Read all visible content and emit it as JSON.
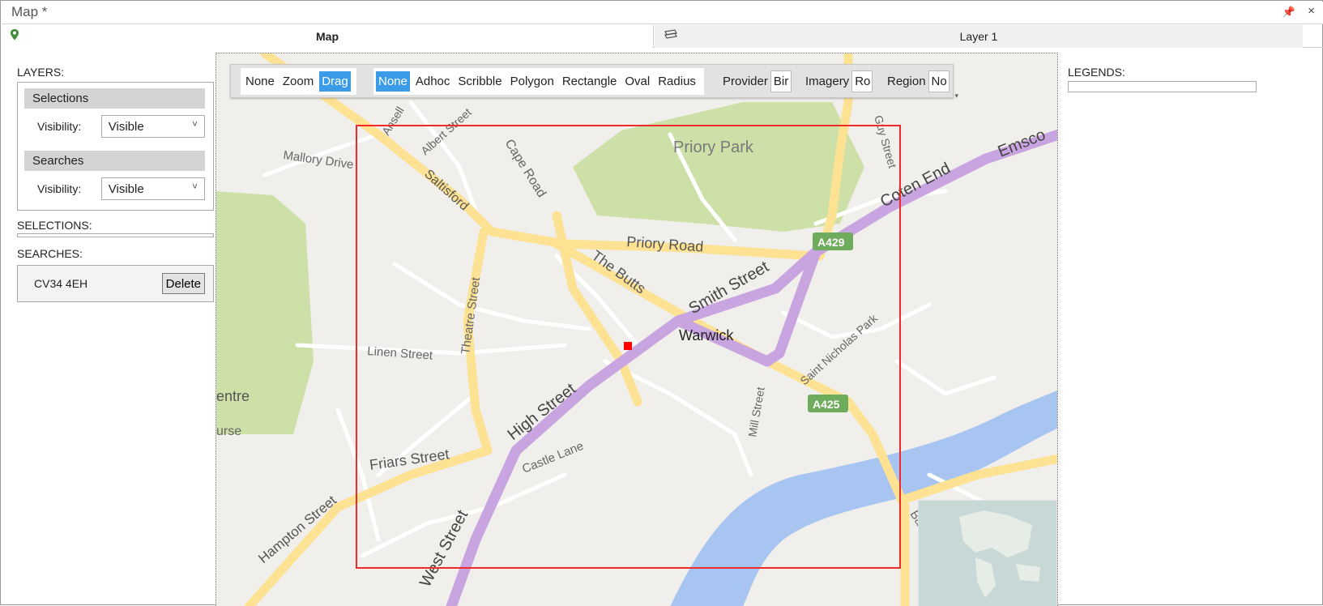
{
  "window": {
    "title": "Map *",
    "pin_icon": "pin-icon",
    "close_icon": "close-icon",
    "pin_glyph": "📌",
    "close_glyph": "×"
  },
  "tabs": [
    {
      "label": "Map",
      "icon": "map-pin-icon",
      "active": true
    },
    {
      "label": "Layer 1",
      "icon": "layers-icon",
      "active": false
    }
  ],
  "layers": {
    "heading": "LAYERS:",
    "groups": [
      {
        "name": "Selections",
        "visibility_label": "Visibility:",
        "visibility_value": "Visible"
      },
      {
        "name": "Searches",
        "visibility_label": "Visibility:",
        "visibility_value": "Visible"
      }
    ]
  },
  "selections": {
    "heading": "SELECTIONS:"
  },
  "searches": {
    "heading": "SEARCHES:",
    "items": [
      {
        "query": "CV34 4EH",
        "delete_label": "Delete"
      }
    ]
  },
  "legends": {
    "heading": "LEGENDS:"
  },
  "toolbar": {
    "mode_buttons": [
      "None",
      "Zoom",
      "Drag"
    ],
    "mode_active": "Drag",
    "shape_buttons": [
      "None",
      "Adhoc",
      "Scribble",
      "Polygon",
      "Rectangle",
      "Oval",
      "Radius"
    ],
    "shape_active": "None",
    "provider_label": "Provider",
    "provider_value": "Bir",
    "imagery_label": "Imagery",
    "imagery_value": "Ro",
    "region_label": "Region",
    "region_value": "No"
  },
  "map": {
    "labels": {
      "priory_park": "Priory Park",
      "warwick": "Warwick",
      "coten_end": "Coten End",
      "emsco": "Emsco",
      "priory_road": "Priory Road",
      "the_butts": "The Butts",
      "smith_street": "Smith Street",
      "high_street": "High Street",
      "west_street": "West Street",
      "friars_street": "Friars Street",
      "hampton_street": "Hampton Street",
      "castle_lane": "Castle Lane",
      "mill_street": "Mill Street",
      "saint_nicholas_park": "Saint Nicholas Park",
      "linen_street": "Linen Street",
      "theatre_street": "Theatre Street",
      "cape_road": "Cape Road",
      "saltisford": "Saltisford",
      "albert_street": "Albert Street",
      "ansell": "Ansell",
      "mallory_drive": "Mallory Drive",
      "guy_street": "Guy Street",
      "banbury": "Banbury R",
      "a429": "A429",
      "a425": "A425",
      "centre": "entre",
      "course": "urse"
    },
    "colors": {
      "background": "#f0efeb",
      "park": "#cde0a8",
      "major_road": "#fde293",
      "highway": "#d8b8ec",
      "water": "#a8c4f0",
      "minor_road": "#ffffff",
      "selection": "#ee2b2b",
      "shield": "#6fab5c"
    }
  }
}
